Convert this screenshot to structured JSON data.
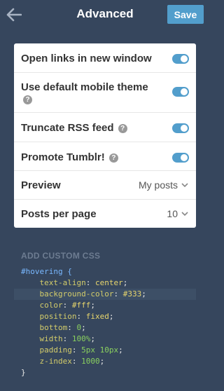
{
  "header": {
    "title": "Advanced",
    "save_label": "Save"
  },
  "settings": {
    "open_links": {
      "label": "Open links in new window",
      "enabled": true
    },
    "mobile_theme": {
      "label": "Use default mobile theme",
      "help": "?",
      "enabled": true
    },
    "truncate_rss": {
      "label": "Truncate RSS feed",
      "help": "?",
      "enabled": true
    },
    "promote_tumblr": {
      "label": "Promote Tumblr!",
      "help": "?",
      "enabled": true
    },
    "preview": {
      "label": "Preview",
      "value": "My posts"
    },
    "posts_per_page": {
      "label": "Posts per page",
      "value": "10"
    }
  },
  "custom_css": {
    "heading": "ADD CUSTOM CSS",
    "selector": "#hovering {",
    "lines": [
      {
        "prop": "text-align",
        "value": "center"
      },
      {
        "prop": "background-color",
        "value": "#333"
      },
      {
        "prop": "color",
        "value": "#fff"
      },
      {
        "prop": "position",
        "value": "fixed"
      },
      {
        "prop": "bottom",
        "value": "0"
      },
      {
        "prop": "width",
        "value": "100%"
      },
      {
        "prop": "padding",
        "value": "5px 10px"
      },
      {
        "prop": "z-index",
        "value": "1000"
      }
    ],
    "closing": "}"
  },
  "colors": {
    "background": "#36465d",
    "accent": "#529ecc"
  },
  "icons": {
    "back": "arrow-left-icon",
    "help": "question-circle-icon",
    "chevron": "chevron-down-icon"
  }
}
